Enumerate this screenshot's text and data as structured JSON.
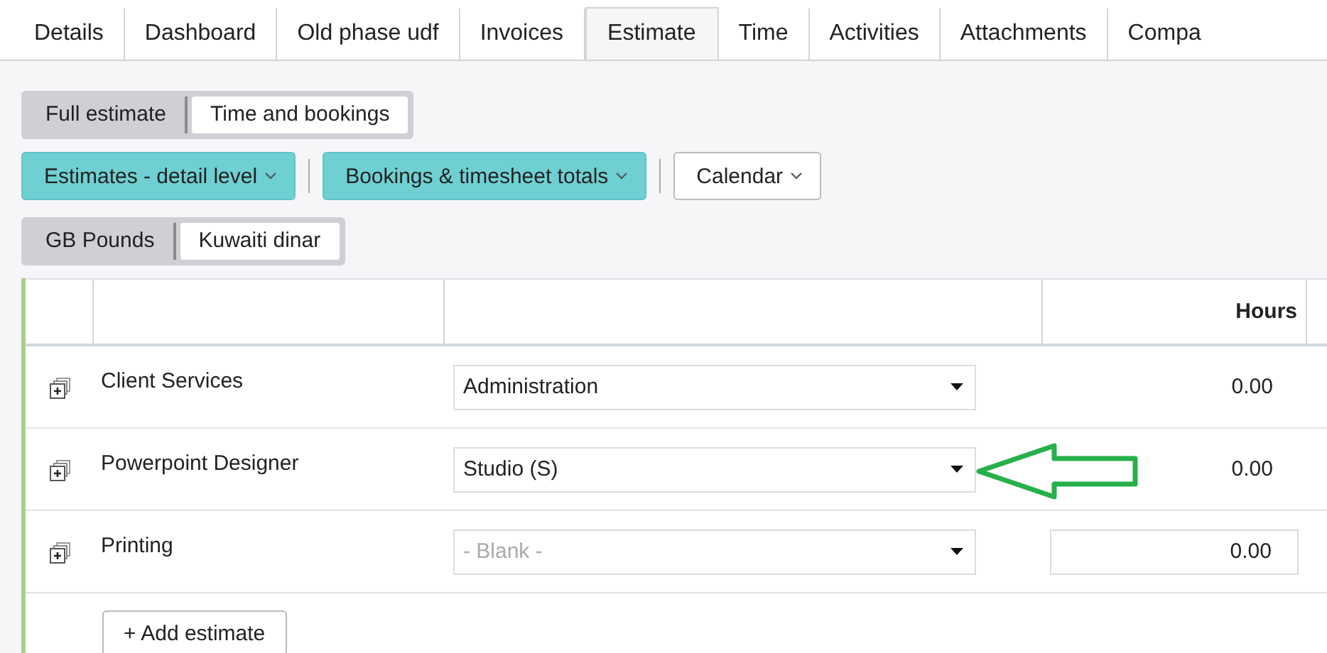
{
  "tabs": [
    {
      "label": "Details",
      "selected": false
    },
    {
      "label": "Dashboard",
      "selected": false
    },
    {
      "label": "Old phase udf",
      "selected": false
    },
    {
      "label": "Invoices",
      "selected": false
    },
    {
      "label": "Estimate",
      "selected": true
    },
    {
      "label": "Time",
      "selected": false
    },
    {
      "label": "Activities",
      "selected": false
    },
    {
      "label": "Attachments",
      "selected": false
    },
    {
      "label": "Compa",
      "selected": false
    }
  ],
  "view_toggle": [
    {
      "label": "Full estimate",
      "selected": false
    },
    {
      "label": "Time and bookings",
      "selected": true
    }
  ],
  "filters": [
    {
      "label": "Estimates - detail level",
      "active": true
    },
    {
      "label": "Bookings & timesheet totals",
      "active": true
    },
    {
      "label": "Calendar",
      "active": false
    }
  ],
  "currency_toggle": [
    {
      "label": "GB Pounds",
      "selected": false
    },
    {
      "label": "Kuwaiti dinar",
      "selected": true
    }
  ],
  "table": {
    "hours_header": "Hours",
    "rows": [
      {
        "name": "Client Services",
        "department": {
          "value": "Administration"
        },
        "hours": {
          "kind": "text",
          "value": "0.00"
        }
      },
      {
        "name": "Powerpoint Designer",
        "department": {
          "value": "Studio (S)"
        },
        "hours": {
          "kind": "text",
          "value": "0.00"
        }
      },
      {
        "name": "Printing",
        "department": {
          "placeholder": "- Blank -"
        },
        "hours": {
          "kind": "input",
          "value": "0.00"
        }
      }
    ],
    "add_button": "+ Add estimate"
  }
}
